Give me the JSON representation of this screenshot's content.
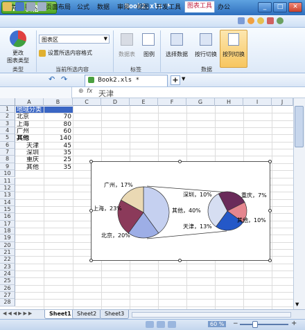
{
  "app": {
    "name": "WPS 表格",
    "document_title": "Book2.xls *"
  },
  "menu": [
    "开始",
    "插入",
    "页面布局",
    "公式",
    "数据",
    "审阅",
    "视图",
    "开发工具",
    "图表工具",
    "办公"
  ],
  "ribbon": {
    "change_type_label_1": "更改",
    "change_type_label_2": "图表类型",
    "element_dropdown_value": "图表区",
    "format_selection_label": "设置所选内容格式",
    "datatable_label": "数据表",
    "legend_label": "图例",
    "select_data_label": "选择数据",
    "switch_row_label": "按行切换",
    "switch_col_label": "按列切换",
    "group_type": "类型",
    "group_current": "当前所选内容",
    "group_labels": "标签",
    "group_data": "数据"
  },
  "doc_tab": "Book2.xls *",
  "formula": {
    "fx": "fx",
    "value": "天津"
  },
  "columns": [
    "A",
    "B",
    "C",
    "D",
    "E",
    "F",
    "G",
    "H",
    "I",
    "J"
  ],
  "rows": [
    "1",
    "2",
    "3",
    "4",
    "5",
    "6",
    "7",
    "8",
    "9",
    "10",
    "11",
    "12",
    "13",
    "14",
    "15",
    "16",
    "17",
    "18",
    "19",
    "20",
    "21",
    "22",
    "23",
    "24",
    "25",
    "26",
    "27",
    "28"
  ],
  "cells": {
    "header": "地域分类",
    "data": [
      {
        "name": "北京",
        "value": "70"
      },
      {
        "name": "上海",
        "value": "80"
      },
      {
        "name": "广州",
        "value": "60"
      },
      {
        "name": "其他",
        "value": "140"
      },
      {
        "name": "天津",
        "value": "45"
      },
      {
        "name": "深圳",
        "value": "35"
      },
      {
        "name": "重庆",
        "value": "25"
      },
      {
        "name": "其他",
        "value": "35"
      }
    ]
  },
  "chart_data": {
    "type": "pie",
    "subtype": "pie-of-pie",
    "main_pie": [
      {
        "label": "广州",
        "value": "17%",
        "color": "#ead9b4"
      },
      {
        "label": "上海",
        "value": "23%",
        "color": "#8b3a5a"
      },
      {
        "label": "北京",
        "value": "20%",
        "color": "#9daee6"
      },
      {
        "label": "其他",
        "value": "40%",
        "color": "#c5d0f0"
      }
    ],
    "secondary_pie": [
      {
        "label": "深圳",
        "value": "10%",
        "color": "#6a2a5a"
      },
      {
        "label": "重庆",
        "value": "7%",
        "color": "#e5868f"
      },
      {
        "label": "其他",
        "value": "10%",
        "color": "#2458c8"
      },
      {
        "label": "天津",
        "value": "13%",
        "color": "#d6def2"
      }
    ]
  },
  "sheet_tabs": [
    "Sheet1",
    "Sheet2",
    "Sheet3"
  ],
  "status": {
    "zoom": "60 %"
  }
}
